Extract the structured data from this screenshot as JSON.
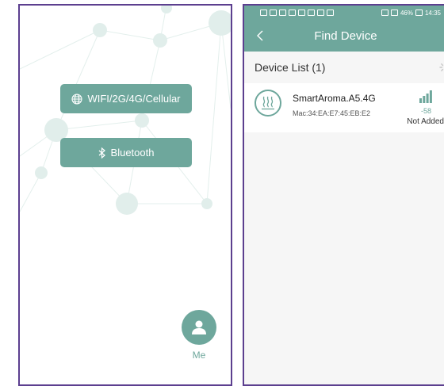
{
  "left_screen": {
    "buttons": [
      {
        "label": "WIFI/2G/4G/Cellular",
        "icon": "globe-icon"
      },
      {
        "label": "Bluetooth",
        "icon": "bluetooth-icon"
      }
    ],
    "nav": {
      "me_label": "Me",
      "icon": "person-icon"
    },
    "accent_color": "#6ea79c",
    "frame_color": "#5c3f8f"
  },
  "right_screen": {
    "status_bar": {
      "left_icons": [
        "carrier-icon",
        "signal-icon",
        "nfc-icon",
        "camera-icon",
        "image-icon",
        "facebook-icon",
        "messenger-icon",
        "notification-icon"
      ],
      "right_text": "46%",
      "time": "14:35"
    },
    "title": "Find Device",
    "back_icon": "chevron-left-icon",
    "list_header": "Device List (1)",
    "devices": [
      {
        "name": "SmartAroma.A5.4G",
        "mac": "Mac:34:EA:E7:45:EB:E2",
        "rssi": "-58",
        "status": "Not Added",
        "signal_bars": 4,
        "icon": "aroma-diffuser-icon"
      }
    ]
  }
}
